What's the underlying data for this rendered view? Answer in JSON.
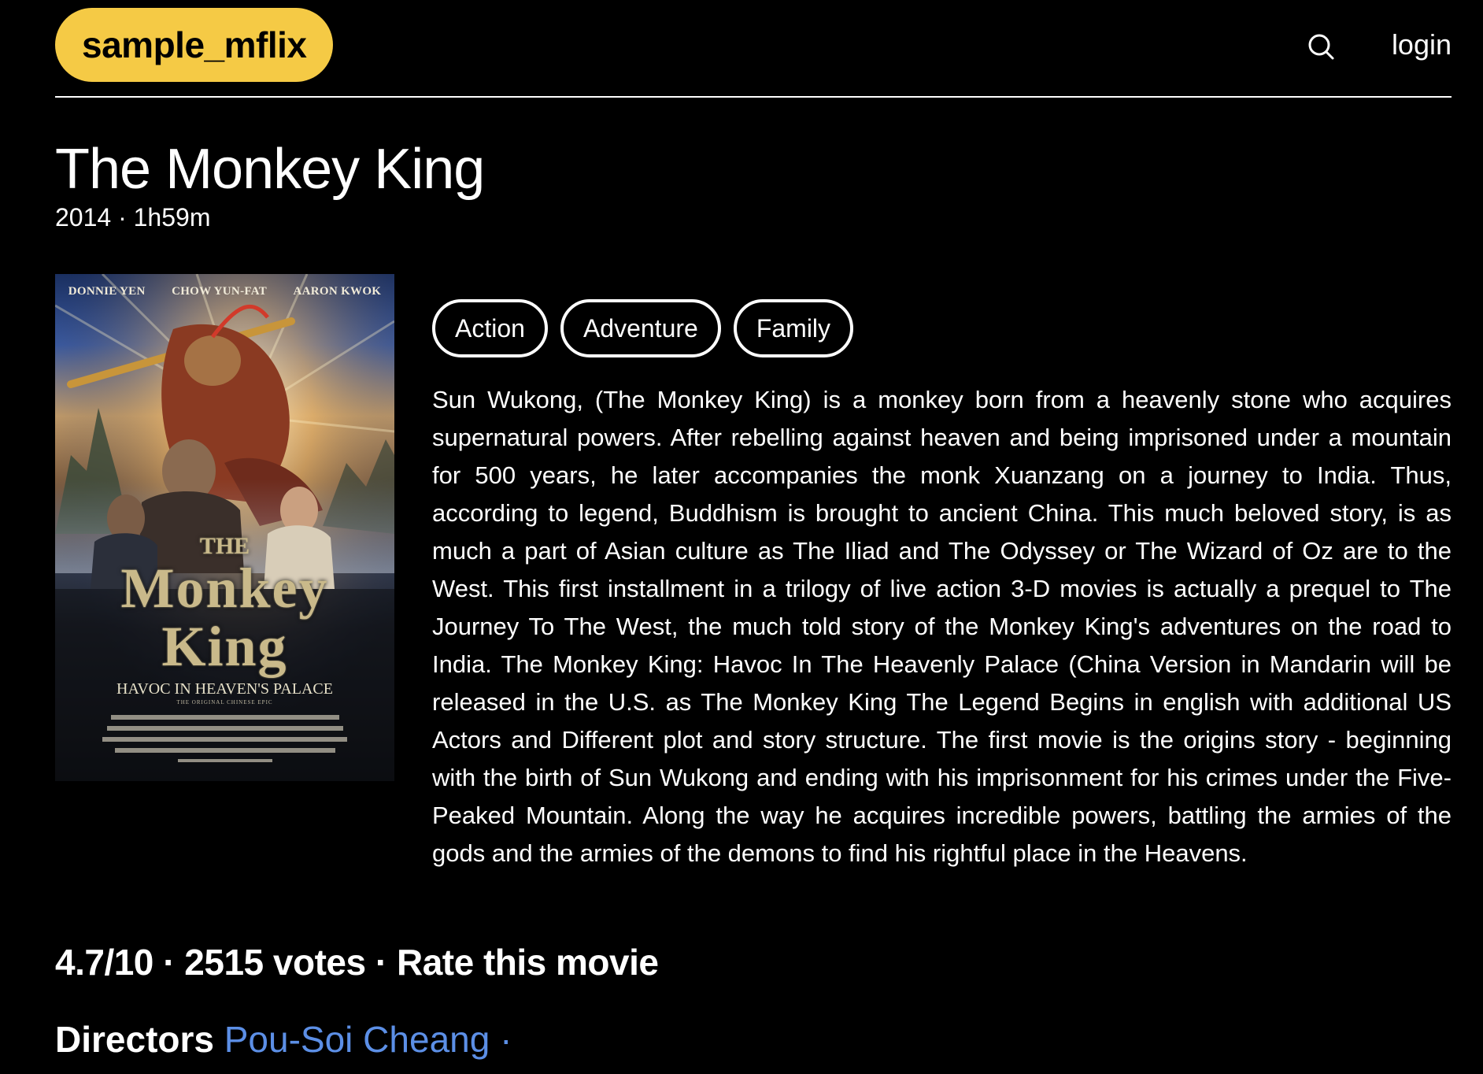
{
  "header": {
    "logo": "sample_mflix",
    "search_icon": "search-icon",
    "login": "login"
  },
  "movie": {
    "title": "The Monkey King",
    "year": "2014",
    "separator": "·",
    "runtime": "1h59m",
    "genres": [
      "Action",
      "Adventure",
      "Family"
    ],
    "plot": "Sun Wukong, (The Monkey King) is a monkey born from a heavenly stone who acquires supernatural powers. After rebelling against heaven and being imprisoned under a mountain for 500 years, he later accompanies the monk Xuanzang on a journey to India. Thus, according to legend, Buddhism is brought to ancient China. This much beloved story, is as much a part of Asian culture as The Iliad and The Odyssey or The Wizard of Oz are to the West. This first installment in a trilogy of live action 3-D movies is actually a prequel to The Journey To The West, the much told story of the Monkey King's adventures on the road to India. The Monkey King: Havoc In The Heavenly Palace (China Version in Mandarin will be released in the U.S. as The Monkey King The Legend Begins in english with additional US Actors and Different plot and story structure. The first movie is the origins story - beginning with the birth of Sun Wukong and ending with his imprisonment for his crimes under the Five-Peaked Mountain. Along the way he acquires incredible powers, battling the armies of the gods and the armies of the demons to find his rightful place in the Heavens.",
    "poster": {
      "billing": [
        "DONNIE YEN",
        "CHOW YUN-FAT",
        "AARON KWOK"
      ],
      "logo_the": "THE",
      "logo_monkey": "Monkey",
      "logo_king": "King",
      "subtitle": "HAVOC IN HEAVEN'S PALACE",
      "tagline": "THE ORIGINAL CHINESE EPIC"
    }
  },
  "rating": {
    "score": "4.7/10",
    "votes": "2515 votes",
    "rate_label": "Rate this movie"
  },
  "directors": {
    "label": "Directors",
    "names": [
      "Pou-Soi Cheang"
    ],
    "trailing": " ·"
  },
  "colors": {
    "brand": "#f5ca45",
    "background": "#000000",
    "link": "#5c8fe6"
  }
}
